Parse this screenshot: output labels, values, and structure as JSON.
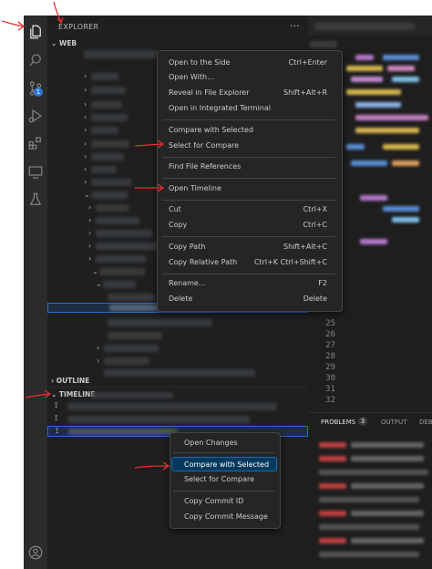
{
  "activity_bar": {
    "icons": [
      "files-icon",
      "search-icon",
      "source-control-icon",
      "run-debug-icon",
      "extensions-icon",
      "remote-explorer-icon",
      "testing-icon",
      "account-icon"
    ],
    "scm_badge": "1"
  },
  "sidebar": {
    "title": "EXPLORER",
    "more": "···",
    "workspace_label": "WEB",
    "outline_label": "OUTLINE",
    "timeline_label": "TIMELINE"
  },
  "explorer_menu": {
    "groups": [
      [
        {
          "label": "Open to the Side",
          "key": "Ctrl+Enter"
        },
        {
          "label": "Open With...",
          "key": ""
        },
        {
          "label": "Reveal in File Explorer",
          "key": "Shift+Alt+R"
        },
        {
          "label": "Open in Integrated Terminal",
          "key": ""
        }
      ],
      [
        {
          "label": "Compare with Selected",
          "key": ""
        },
        {
          "label": "Select for Compare",
          "key": ""
        }
      ],
      [
        {
          "label": "Find File References",
          "key": ""
        }
      ],
      [
        {
          "label": "Open Timeline",
          "key": ""
        }
      ],
      [
        {
          "label": "Cut",
          "key": "Ctrl+X"
        },
        {
          "label": "Copy",
          "key": "Ctrl+C"
        }
      ],
      [
        {
          "label": "Copy Path",
          "key": "Shift+Alt+C"
        },
        {
          "label": "Copy Relative Path",
          "key": "Ctrl+K Ctrl+Shift+C"
        }
      ],
      [
        {
          "label": "Rename...",
          "key": "F2"
        },
        {
          "label": "Delete",
          "key": "Delete"
        }
      ]
    ]
  },
  "timeline_menu": {
    "items": [
      "Open Changes",
      "Compare with Selected",
      "Select for Compare",
      "Copy Commit ID",
      "Copy Commit Message"
    ],
    "highlighted": "Compare with Selected"
  },
  "editor": {
    "line_numbers": [
      "25",
      "26",
      "27",
      "28",
      "29",
      "30",
      "31",
      "32"
    ]
  },
  "panel": {
    "tabs": [
      "PROBLEMS",
      "OUTPUT",
      "DEBI"
    ],
    "problems_count": "3"
  },
  "colors": {
    "accent": "#2a6bd1",
    "annotation_arrow": "#e03030",
    "menu_bg": "#252526",
    "sidebar_bg": "#1f1f1f"
  }
}
